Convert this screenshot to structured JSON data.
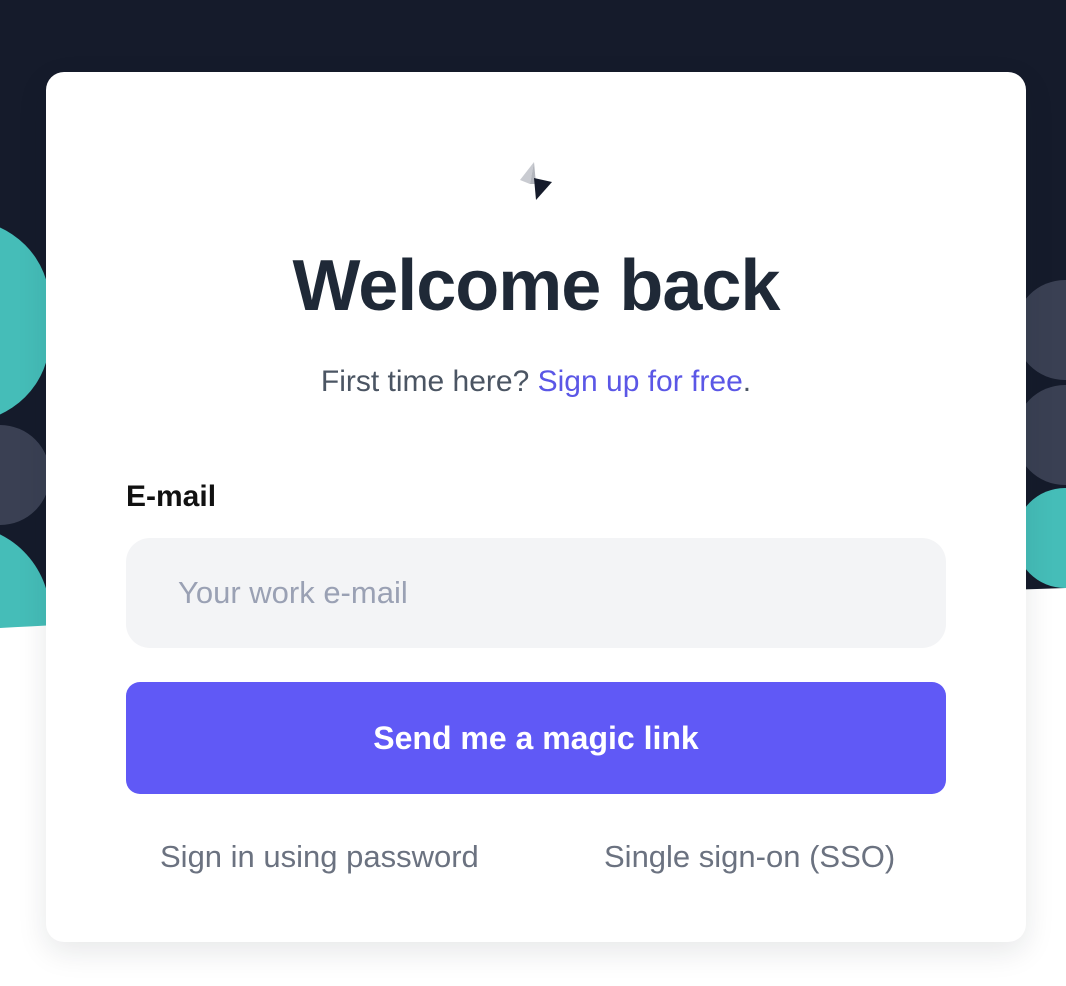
{
  "colors": {
    "background_dark": "#151b2b",
    "shape_teal": "#45bdb8",
    "shape_slate": "#3a4053",
    "accent": "#6059f6",
    "link": "#5b57e6",
    "input_bg": "#f3f4f6"
  },
  "logo": {
    "icon": "bolt-logo-icon"
  },
  "header": {
    "title": "Welcome back",
    "subtitle_prefix": "First time here? ",
    "signup_link": "Sign up for free",
    "subtitle_suffix": "."
  },
  "form": {
    "email_label": "E-mail",
    "email_placeholder": "Your work e-mail",
    "email_value": "",
    "submit_label": "Send me a magic link"
  },
  "alternatives": {
    "password_link": "Sign in using password",
    "sso_link": "Single sign-on (SSO)"
  }
}
